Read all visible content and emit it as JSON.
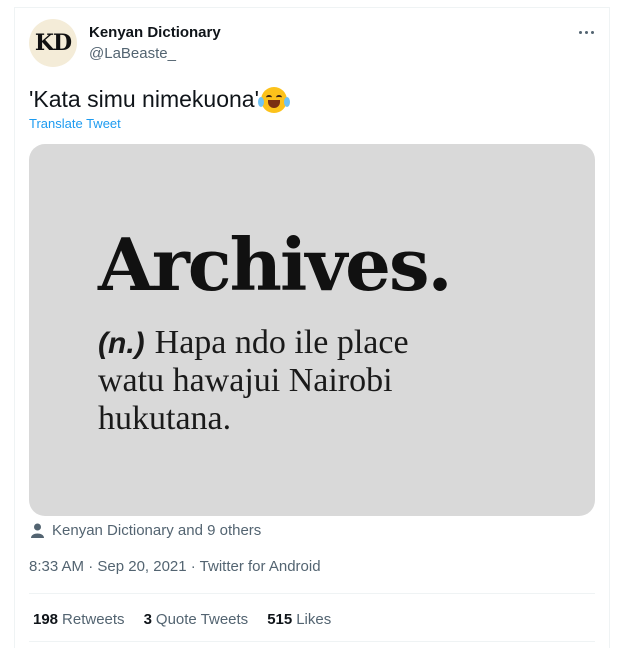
{
  "author": {
    "avatar_text": "KD",
    "display_name": "Kenyan Dictionary",
    "handle": "@LaBeaste_"
  },
  "tweet": {
    "text": "'Kata simu nimekuona'",
    "emoji": "face-with-tears-of-joy",
    "translate_label": "Translate Tweet"
  },
  "media": {
    "word": "Archives.",
    "part_of_speech": "(n.)",
    "definition_lines": [
      "Hapa ndo ile place",
      "watu hawajui Nairobi",
      "hukutana."
    ],
    "background": "#d9d9d9"
  },
  "tagged": "Kenyan Dictionary and 9 others",
  "timestamp": "8:33 AM · Sep 20, 2021 · Twitter for Android",
  "stats": [
    {
      "count": "198",
      "label": "Retweets"
    },
    {
      "count": "3",
      "label": "Quote Tweets"
    },
    {
      "count": "515",
      "label": "Likes"
    }
  ],
  "colors": {
    "link": "#1d9bf0",
    "secondary_text": "#536471",
    "primary_text": "#0f1419"
  }
}
